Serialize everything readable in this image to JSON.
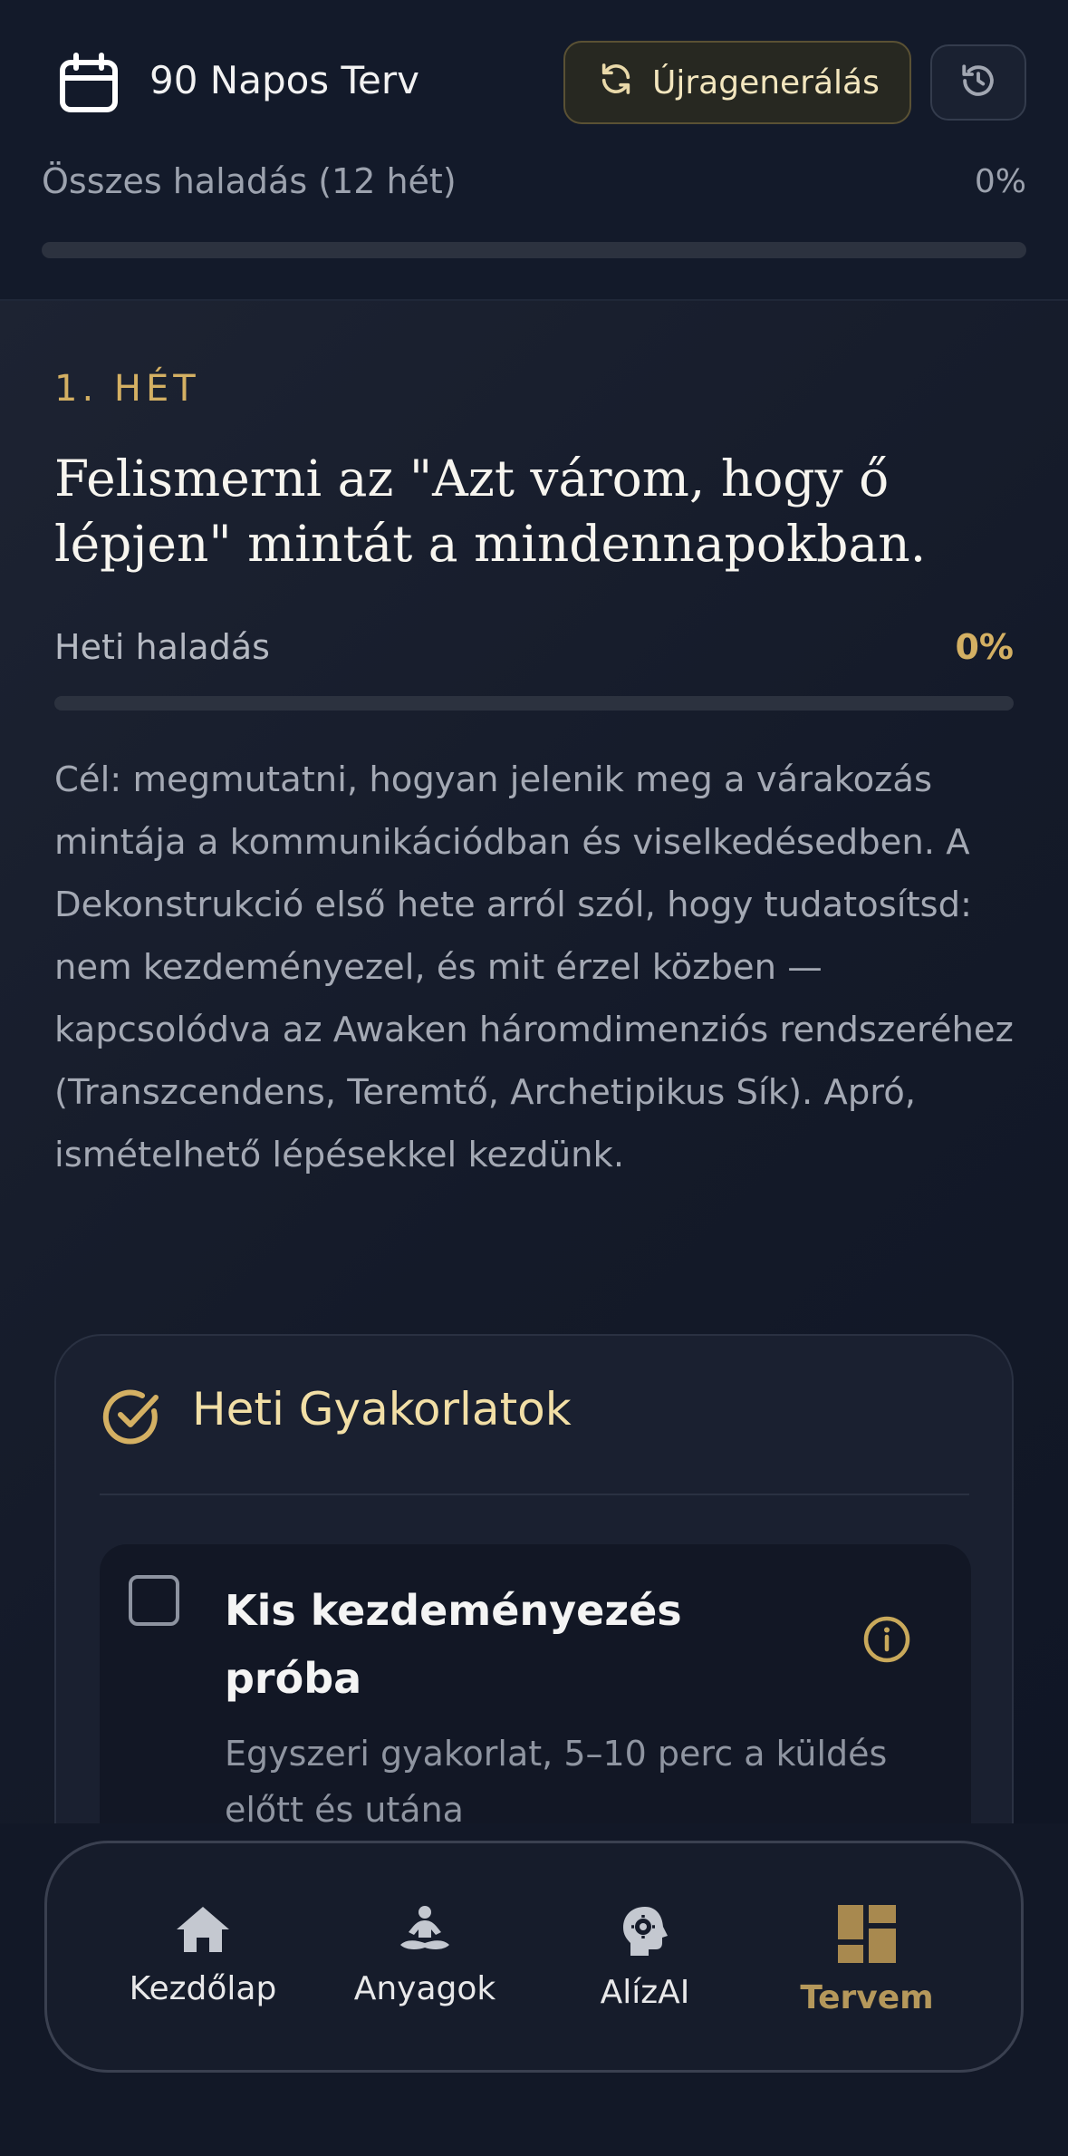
{
  "header": {
    "title": "90 Napos Terv",
    "regenerate_label": "Újragenerálás",
    "overall_progress_label": "Összes haladás (12 hét)",
    "overall_progress_value": "0%",
    "overall_progress_fraction": 0
  },
  "week": {
    "label": "1. HÉT",
    "title": "Felismerni az \"Azt várom, hogy ő lépjen\" mintát a mindennapokban.",
    "progress_label": "Heti haladás",
    "progress_value": "0%",
    "progress_fraction": 0,
    "description": "Cél: megmutatni, hogyan jelenik meg a várakozás mintája a kommunikációdban és viselkedésedben. A Dekonstrukció első hete arról szól, hogy tudatosítsd: nem kezdeményezel, és mit érzel közben — kapcsolódva az Awaken háromdimenziós rendszeréhez (Transzcendens, Teremtő, Archetipikus Sík). Apró, ismételhető lépésekkel kezdünk."
  },
  "exercises_card": {
    "title": "Heti Gyakorlatok",
    "items": [
      {
        "title": "Kis kezdeményezés próba",
        "description": "Egyszeri gyakorlat, 5–10 perc a küldés előtt és utána",
        "checked": false
      }
    ]
  },
  "nav": {
    "items": [
      {
        "label": "Kezdőlap",
        "icon": "home-icon",
        "active": false
      },
      {
        "label": "Anyagok",
        "icon": "meditation-icon",
        "active": false
      },
      {
        "label": "AlízAI",
        "icon": "ai-head-icon",
        "active": false
      },
      {
        "label": "Tervem",
        "icon": "dashboard-icon",
        "active": true
      }
    ]
  },
  "colors": {
    "background": "#121827",
    "accent_gold": "#d4b063",
    "active_nav": "#b5985b",
    "muted_text": "#a4a9b4"
  }
}
